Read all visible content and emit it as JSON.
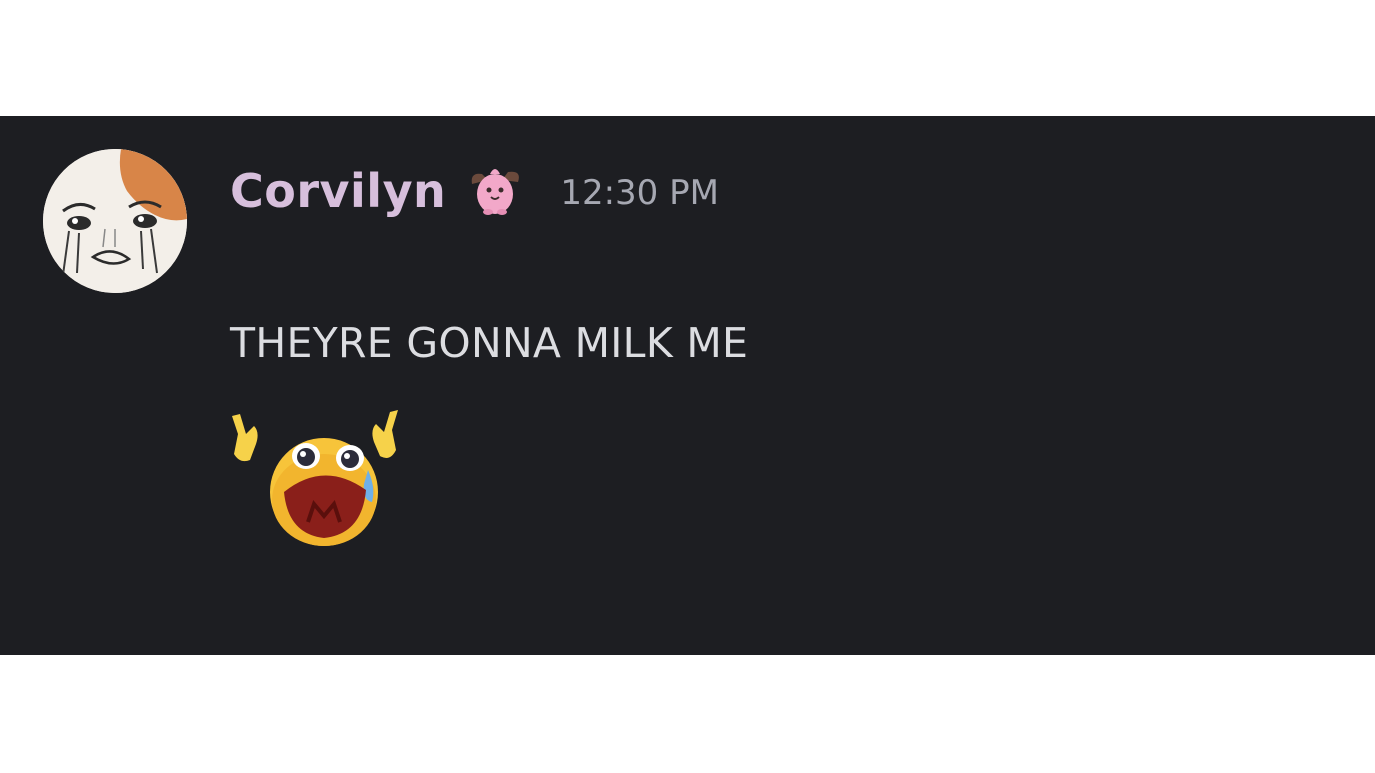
{
  "message": {
    "author": "Corvilyn",
    "timestamp": "12:30 PM",
    "text": "THEYRE GONNA MILK ME",
    "author_color": "#d7bfdc",
    "avatar": "crying-cartoon-avatar",
    "badge_icon": "pink-creature-badge-icon",
    "attachment_emoji": "crying-screaming-emoji"
  },
  "theme": {
    "panel_background": "#1d1e22",
    "text_color": "#dcdde1",
    "timestamp_color": "#a6a8b2"
  }
}
